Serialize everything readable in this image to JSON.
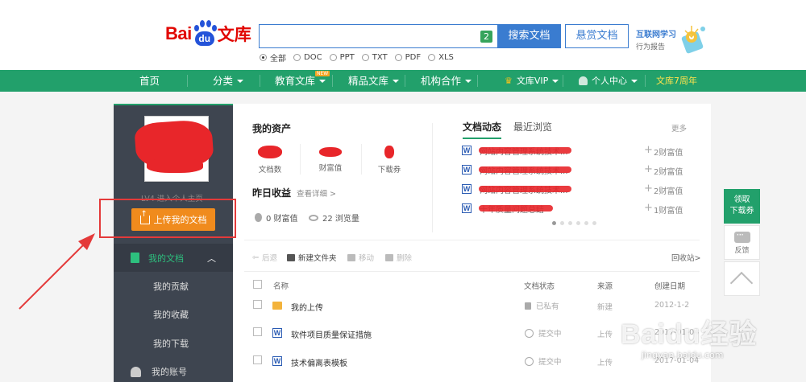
{
  "header": {
    "logo": {
      "bai": "Bai",
      "du": "du",
      "wenku": "文库"
    },
    "search": {
      "value": "",
      "count_badge": "2",
      "search_button": "搜索文档",
      "reward_button": "悬赏文档"
    },
    "report": {
      "line1": "互联网学习",
      "line2": "行为报告"
    },
    "doc_types": [
      {
        "label": "全部",
        "selected": true
      },
      {
        "label": "DOC",
        "selected": false
      },
      {
        "label": "PPT",
        "selected": false
      },
      {
        "label": "TXT",
        "selected": false
      },
      {
        "label": "PDF",
        "selected": false
      },
      {
        "label": "XLS",
        "selected": false
      }
    ]
  },
  "nav": {
    "items": [
      "首页",
      "分类",
      "教育文库",
      "精品文库",
      "机构合作",
      "文库VIP",
      "个人中心",
      "文库7周年"
    ],
    "new_badge": "NEW"
  },
  "sidebar": {
    "level_text": "LV4  进入个人主页",
    "upload_button": "上传我的文档",
    "section": "我的文档",
    "links": [
      "我的贡献",
      "我的收藏",
      "我的下载"
    ],
    "account": "我的账号"
  },
  "assets": {
    "title": "我的资产",
    "items": [
      "文档数",
      "财富值",
      "下载券"
    ],
    "yesterday_title": "昨日收益",
    "yesterday_detail": "查看详细 >",
    "wealth": "0 财富值",
    "views": "22 浏览量"
  },
  "dynamics": {
    "tabs": [
      "文档动态",
      "最近浏览"
    ],
    "more": "更多",
    "rows": [
      {
        "text": "网站内容管理系统技术...",
        "value": "2财富值"
      },
      {
        "text": "网站内容管理系统技术...",
        "value": "2财富值"
      },
      {
        "text": "网站内容管理系统技术...",
        "value": "2财富值"
      },
      {
        "text": "十年质量问题总结",
        "value": "1财富值"
      }
    ]
  },
  "toolbar": {
    "back": "后退",
    "new_folder": "新建文件夹",
    "move": "移动",
    "delete": "删除",
    "recycle": "回收站>"
  },
  "table": {
    "headers": [
      "名称",
      "文档状态",
      "来源",
      "创建日期"
    ],
    "rows": [
      {
        "name": "我的上传",
        "status": "已私有",
        "source": "新建",
        "date": "2012-1-2",
        "icon": "folder-icon"
      },
      {
        "name": "软件项目质量保证措施",
        "status": "提交中",
        "source": "上传",
        "date": "2017-01-04",
        "icon": "word-icon"
      },
      {
        "name": "技术偏离表模板",
        "status": "提交中",
        "source": "上传",
        "date": "2017-01-04",
        "icon": "word-icon"
      }
    ]
  },
  "float": {
    "claim": "领取\n下载券",
    "claim_1": "领取",
    "claim_2": "下载券",
    "feedback": "反馈"
  },
  "watermark": {
    "big": "Baidu经验",
    "small": "jingyan.baidu.com"
  },
  "colors": {
    "brand_green": "#22a06b",
    "brand_blue": "#3a7cd0",
    "upload_orange": "#f08b1d",
    "annotation_red": "#e43a3a"
  }
}
